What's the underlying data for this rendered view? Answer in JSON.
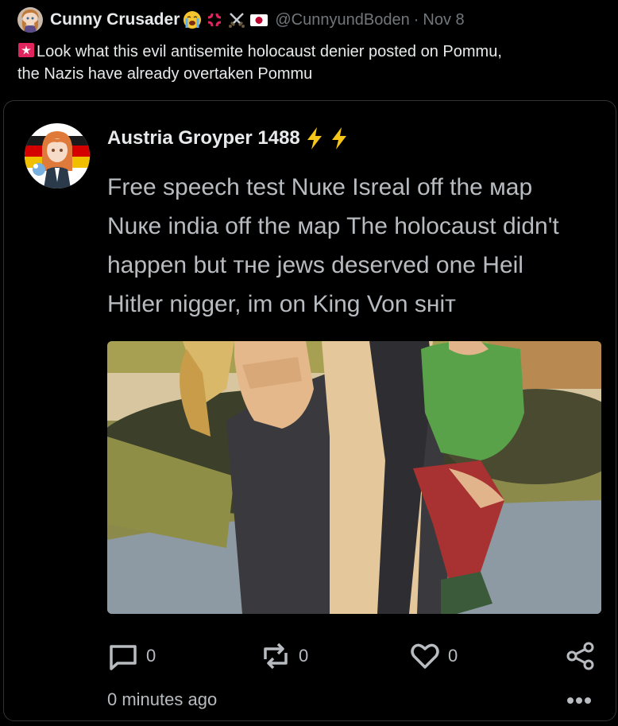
{
  "outer_post": {
    "display_name": "Cunny Crusader",
    "emojis": [
      "loudly-crying-face-emoji",
      "anger-symbol-emoji",
      "crossed-swords-emoji",
      "japan-flag-emoji"
    ],
    "handle": "@CunnyundBoden",
    "separator": "·",
    "date": "Nov 8",
    "text_line_1": "Look what this evil antisemite holocaust denier posted on Pommu,",
    "text_line_2": "the Nazis have already overtaken Pommu"
  },
  "quoted_post": {
    "display_name": "Austria Groyper 1488",
    "name_icons": [
      "lightning-bolt-icon",
      "lightning-bolt-icon"
    ],
    "text_lines": [
      "Free speech test Nuкe Isreal off the мap",
      "Nuкe india off the мap The holocaust didn't",
      "happen but тнe jews deserved one Heil",
      "Hitler nigger, im on King Von sнiт"
    ],
    "media_description": "anime-style illustration image",
    "actions": {
      "reply_count": "0",
      "repost_count": "0",
      "like_count": "0"
    },
    "timestamp": "0 minutes ago"
  },
  "colors": {
    "background": "#000000",
    "primary_text": "#e7e9ea",
    "secondary_text": "#71767b",
    "body_text": "#b8bcc0",
    "border": "#2f3336",
    "accent_yellow": "#f5c518"
  }
}
